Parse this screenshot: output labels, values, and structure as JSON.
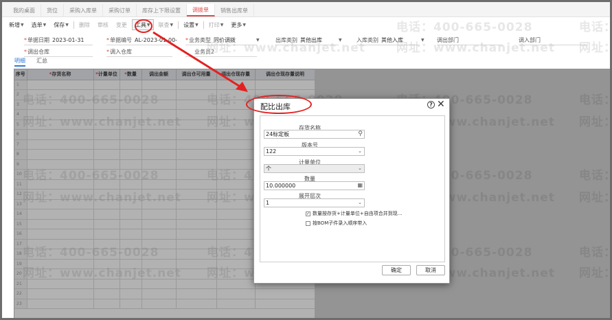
{
  "tabs": [
    {
      "label": "我的桌面"
    },
    {
      "label": "货位"
    },
    {
      "label": "采购入库单"
    },
    {
      "label": "采购订单"
    },
    {
      "label": "库存上下限设置"
    },
    {
      "label": "调拨单",
      "active": true
    },
    {
      "label": "销售出库单"
    }
  ],
  "toolbar": {
    "new": "新增",
    "select_bill": "选单",
    "save": "保存",
    "delete": "删除",
    "audit": "审核",
    "change": "变更",
    "tools": "工具",
    "query": "联查",
    "settings": "设置",
    "print": "打印",
    "more": "更多"
  },
  "form": {
    "doc_date_label": "单据日期",
    "doc_date": "2023-01-31",
    "doc_no_label": "单据编号",
    "doc_no": "AL-2023-01-00-",
    "biz_type_label": "业务类型",
    "biz_type": "同价调拨",
    "out_type_label": "出库类别",
    "out_type": "其他出库",
    "in_type_label": "入库类别",
    "in_type": "其他入库",
    "out_dept_label": "调出部门",
    "in_dept_label": "调入部门",
    "out_wh_label": "调出仓库",
    "in_wh_label": "调入仓库",
    "clerk_label": "业务员2"
  },
  "subtabs": [
    "明细",
    "汇总"
  ],
  "grid": {
    "columns": [
      "序号",
      "存货名称",
      "计量单位",
      "数量",
      "调出金额",
      "调出仓可用量",
      "调出仓现存量",
      "调出仓现存量说明"
    ],
    "required": [
      false,
      true,
      true,
      true,
      false,
      false,
      false,
      false
    ],
    "rows": [
      "1",
      "2",
      "3",
      "4",
      "5",
      "6",
      "7",
      "8",
      "9",
      "10",
      "11",
      "12",
      "13",
      "14",
      "15",
      "16",
      "17",
      "18",
      "19",
      "20",
      "21",
      "22",
      "23"
    ]
  },
  "watermark": {
    "phone": "电话：400-665-0028",
    "site": "网址：www.chanjet.net"
  },
  "dialog": {
    "title": "配比出库",
    "inventory_label": "存货名称",
    "inventory_value": "24标定板",
    "version_label": "版本号",
    "version_value": "122",
    "unit_label": "计量单位",
    "unit_value": "个",
    "qty_label": "数量",
    "qty_value": "10.000000",
    "expand_label": "展开层次",
    "expand_value": "1",
    "merge_check_label": "数量按存货+计量单位+自由项合并到现…",
    "merge_checked": true,
    "bom_check_label": "按BOM子件录入顺序带入",
    "bom_checked": false,
    "ok": "确定",
    "cancel": "取消"
  },
  "colors": {
    "accent_red": "#e04848",
    "annotation_red": "#e52020",
    "link_blue": "#2f7bd8"
  }
}
